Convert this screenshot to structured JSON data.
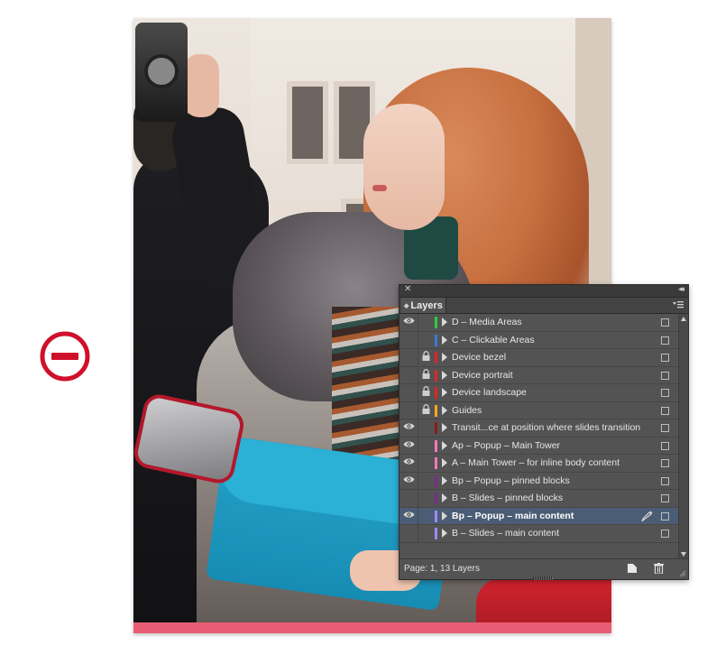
{
  "panel": {
    "title": "Layers",
    "footer_status": "Page: 1, 13 Layers",
    "icons": {
      "close": "close-icon",
      "collapse": "double-chevron-icon",
      "menu": "panel-menu-icon",
      "new_layer": "new-layer-icon",
      "delete": "trash-icon"
    }
  },
  "layers": [
    {
      "name": "D – Media Areas",
      "visible": true,
      "locked": false,
      "color": "#2ecc40",
      "selected": false
    },
    {
      "name": "C – Clickable Areas",
      "visible": false,
      "locked": false,
      "color": "#3a7bd5",
      "selected": false
    },
    {
      "name": "Device bezel",
      "visible": false,
      "locked": true,
      "color": "#e02424",
      "selected": false
    },
    {
      "name": "Device portrait",
      "visible": false,
      "locked": true,
      "color": "#e02424",
      "selected": false
    },
    {
      "name": "Device landscape",
      "visible": false,
      "locked": true,
      "color": "#e02424",
      "selected": false
    },
    {
      "name": "Guides",
      "visible": false,
      "locked": true,
      "color": "#f5a623",
      "selected": false
    },
    {
      "name": "Transit...ce at position where slides transition",
      "visible": true,
      "locked": false,
      "color": "#8b1a1a",
      "selected": false
    },
    {
      "name": "Ap – Popup – Main Tower",
      "visible": true,
      "locked": false,
      "color": "#f07ab8",
      "selected": false
    },
    {
      "name": "A – Main Tower – for inline body content",
      "visible": true,
      "locked": false,
      "color": "#f07ab8",
      "selected": false
    },
    {
      "name": "Bp – Popup – pinned blocks",
      "visible": true,
      "locked": false,
      "color": "#7b2a8c",
      "selected": false
    },
    {
      "name": "B – Slides – pinned blocks",
      "visible": false,
      "locked": false,
      "color": "#7b2a8c",
      "selected": false
    },
    {
      "name": "Bp – Popup – main content",
      "visible": true,
      "locked": false,
      "color": "#9b8cf0",
      "selected": true
    },
    {
      "name": "B – Slides – main content",
      "visible": false,
      "locked": false,
      "color": "#9b8cf0",
      "selected": false
    }
  ],
  "indicator": {
    "icon": "minus-circle-icon",
    "color": "#d0102a"
  },
  "colors": {
    "panel_bg": "#535353",
    "selected_row": "#4b5d74"
  }
}
